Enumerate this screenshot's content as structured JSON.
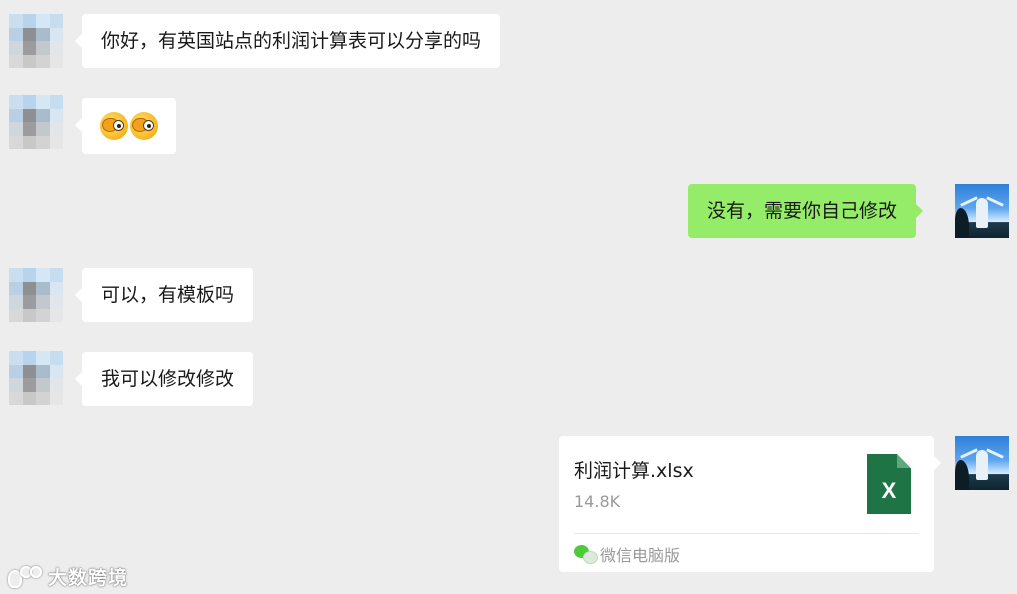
{
  "colors": {
    "background": "#ededed",
    "incoming_bubble": "#ffffff",
    "outgoing_bubble": "#95ec69",
    "excel_green": "#1f7446"
  },
  "messages": [
    {
      "side": "left",
      "text": "你好，有英国站点的利润计算表可以分享的吗"
    },
    {
      "side": "left",
      "type": "emoji",
      "emoji": [
        "grimace-emoji",
        "grimace-emoji"
      ]
    },
    {
      "side": "right",
      "text": "没有，需要你自己修改"
    },
    {
      "side": "left",
      "text": "可以，有模板吗"
    },
    {
      "side": "left",
      "text": "我可以修改修改"
    },
    {
      "side": "right",
      "type": "file",
      "file": {
        "name": "利润计算.xlsx",
        "size": "14.8K",
        "icon": "excel-file-icon",
        "icon_letter": "X",
        "source": "微信电脑版",
        "source_icon": "wechat-icon"
      }
    }
  ],
  "watermark": {
    "text": "大数跨境"
  }
}
